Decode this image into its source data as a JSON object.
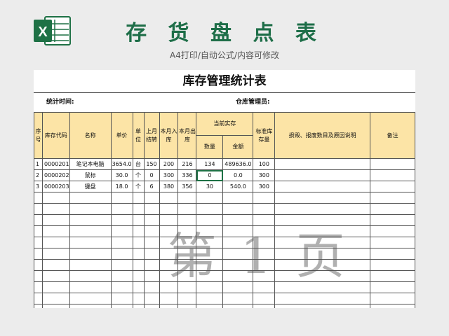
{
  "header": {
    "title": "存 货 盘 点 表",
    "subtitle": "A4打印/自动公式/内容可修改",
    "logo_icon": "excel-icon",
    "accent_color": "#1e6e48"
  },
  "sheet": {
    "title": "库存管理统计表",
    "stat_time_label": "统计时间:",
    "manager_label": "仓库管理员:",
    "watermark": "第 1 页",
    "header_fill_color": "#fce4a6"
  },
  "table": {
    "headers": {
      "seq": "序号",
      "code": "库存代码",
      "name": "名称",
      "price": "单价",
      "unit": "单位",
      "carry": "上月结转",
      "in": "本月入库",
      "out": "本月出库",
      "current": "当前实存",
      "qty": "数量",
      "amount": "金额",
      "standard": "标准库存量",
      "explain": "损毁、报废数目及原因说明",
      "note": "备注"
    },
    "rows": [
      {
        "seq": "1",
        "code": "0000201",
        "name": "笔记本电脑",
        "price": "3654.0",
        "unit": "台",
        "carry": "150",
        "in": "200",
        "out": "216",
        "qty": "134",
        "amount": "489636.0",
        "standard": "100",
        "explain": "",
        "note": ""
      },
      {
        "seq": "2",
        "code": "0000202",
        "name": "鼠标",
        "price": "30.0",
        "unit": "个",
        "carry": "0",
        "in": "300",
        "out": "336",
        "qty": "0",
        "amount": "0.0",
        "standard": "300",
        "explain": "",
        "note": ""
      },
      {
        "seq": "3",
        "code": "0000203",
        "name": "键盘",
        "price": "18.0",
        "unit": "个",
        "carry": "6",
        "in": "380",
        "out": "356",
        "qty": "30",
        "amount": "540.0",
        "standard": "300",
        "explain": "",
        "note": ""
      }
    ],
    "empty_row_count": 12
  }
}
